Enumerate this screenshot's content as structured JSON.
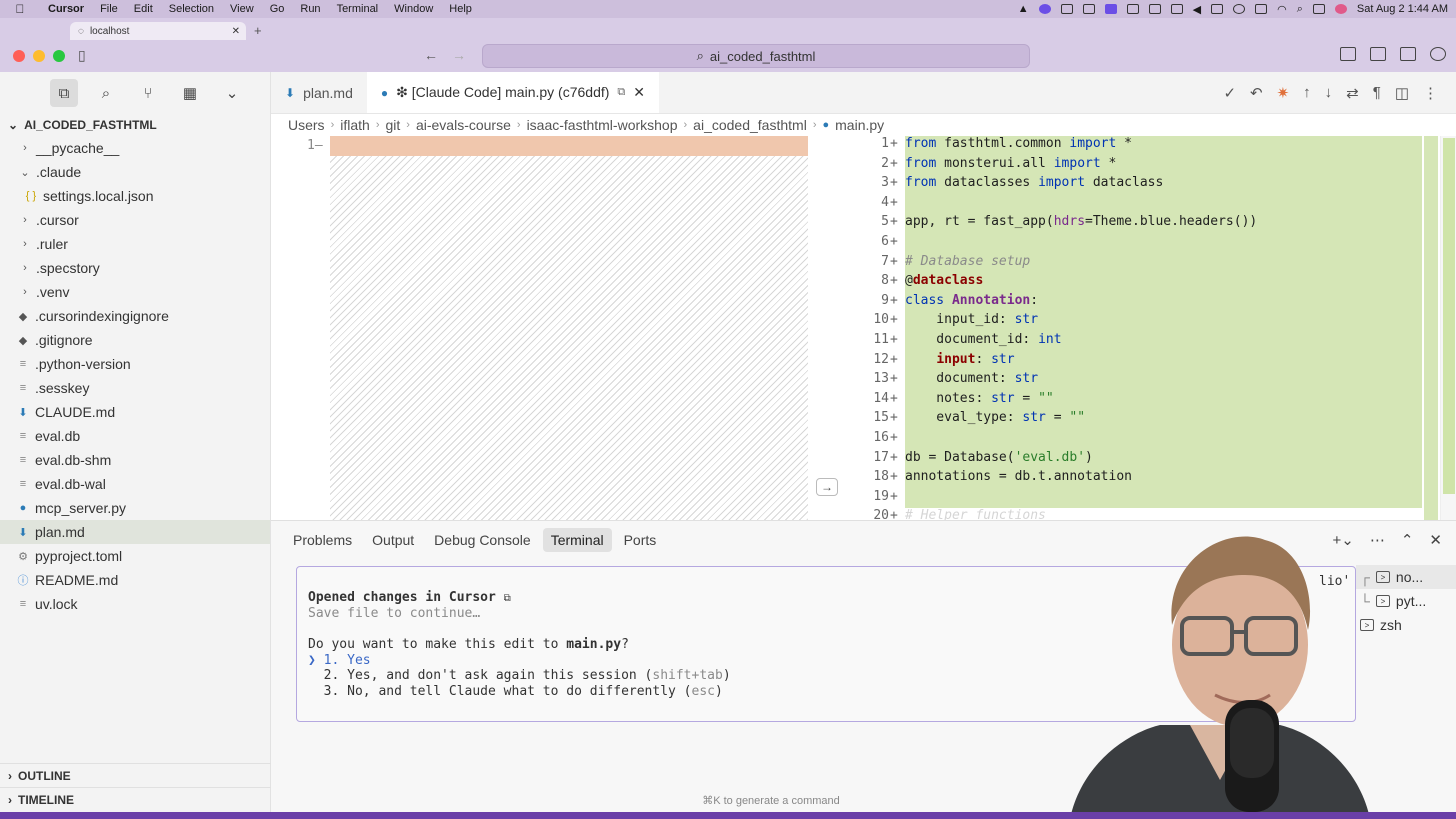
{
  "menubar": {
    "apple": "",
    "items": [
      "Cursor",
      "File",
      "Edit",
      "Selection",
      "View",
      "Go",
      "Run",
      "Terminal",
      "Window",
      "Help"
    ],
    "clock": "Sat Aug 2  1:44 AM",
    "zoom_label": "zm"
  },
  "browser_tab": {
    "title": "localhost"
  },
  "titlebar": {
    "search": "ai_coded_fasthtml"
  },
  "sidebar": {
    "root": "AI_CODED_FASTHTML",
    "items": [
      {
        "label": "__pycache__",
        "kind": "folder",
        "depth": 1,
        "open": false
      },
      {
        "label": ".claude",
        "kind": "folder",
        "depth": 1,
        "open": true
      },
      {
        "label": "settings.local.json",
        "kind": "json",
        "depth": 2
      },
      {
        "label": ".cursor",
        "kind": "folder",
        "depth": 1,
        "open": false
      },
      {
        "label": ".ruler",
        "kind": "folder",
        "depth": 1,
        "open": false
      },
      {
        "label": ".specstory",
        "kind": "folder",
        "depth": 1,
        "open": false
      },
      {
        "label": ".venv",
        "kind": "folder",
        "depth": 1,
        "open": false
      },
      {
        "label": ".cursorindexingignore",
        "kind": "git",
        "depth": 1
      },
      {
        "label": ".gitignore",
        "kind": "git",
        "depth": 1
      },
      {
        "label": ".python-version",
        "kind": "plain",
        "depth": 1
      },
      {
        "label": ".sesskey",
        "kind": "plain",
        "depth": 1
      },
      {
        "label": "CLAUDE.md",
        "kind": "md",
        "depth": 1
      },
      {
        "label": "eval.db",
        "kind": "plain",
        "depth": 1
      },
      {
        "label": "eval.db-shm",
        "kind": "plain",
        "depth": 1
      },
      {
        "label": "eval.db-wal",
        "kind": "plain",
        "depth": 1
      },
      {
        "label": "mcp_server.py",
        "kind": "py",
        "depth": 1
      },
      {
        "label": "plan.md",
        "kind": "md",
        "depth": 1,
        "selected": true
      },
      {
        "label": "pyproject.toml",
        "kind": "gear",
        "depth": 1
      },
      {
        "label": "README.md",
        "kind": "info",
        "depth": 1
      },
      {
        "label": "uv.lock",
        "kind": "plain",
        "depth": 1
      }
    ],
    "outline": "OUTLINE",
    "timeline": "TIMELINE"
  },
  "editor": {
    "tabs": [
      {
        "label": "plan.md",
        "active": false
      },
      {
        "label": "❇ [Claude Code] main.py (c76ddf)",
        "active": true
      }
    ],
    "breadcrumb": [
      "Users",
      "iflath",
      "git",
      "ai-evals-course",
      "isaac-fasthtml-workshop",
      "ai_coded_fasthtml",
      "main.py"
    ],
    "left_line_number": "1",
    "lines": [
      {
        "n": "1",
        "code": "from fasthtml.common import *"
      },
      {
        "n": "2",
        "code": "from monsterui.all import *"
      },
      {
        "n": "3",
        "code": "from dataclasses import dataclass"
      },
      {
        "n": "4",
        "code": ""
      },
      {
        "n": "5",
        "code": "app, rt = fast_app(hdrs=Theme.blue.headers())"
      },
      {
        "n": "6",
        "code": ""
      },
      {
        "n": "7",
        "code": "# Database setup"
      },
      {
        "n": "8",
        "code": "@dataclass"
      },
      {
        "n": "9",
        "code": "class Annotation:"
      },
      {
        "n": "10",
        "code": "    input_id: str"
      },
      {
        "n": "11",
        "code": "    document_id: int"
      },
      {
        "n": "12",
        "code": "    input: str"
      },
      {
        "n": "13",
        "code": "    document: str"
      },
      {
        "n": "14",
        "code": "    notes: str = \"\""
      },
      {
        "n": "15",
        "code": "    eval_type: str = \"\""
      },
      {
        "n": "16",
        "code": ""
      },
      {
        "n": "17",
        "code": "db = Database('eval.db')"
      },
      {
        "n": "18",
        "code": "annotations = db.t.annotation"
      },
      {
        "n": "19",
        "code": ""
      },
      {
        "n": "20",
        "code": "# Helper functions"
      }
    ]
  },
  "panel": {
    "tabs": [
      "Problems",
      "Output",
      "Debug Console",
      "Terminal",
      "Ports"
    ],
    "active_tab": "Terminal",
    "terminal": {
      "opened": "Opened changes in Cursor",
      "save": "Save file to continue…",
      "question_prefix": "Do you want to make this edit to ",
      "question_file": "main.py",
      "question_suffix": "?",
      "opt1": "❯ 1. Yes",
      "opt2_main": "  2. Yes, and don't ask again this session (",
      "opt2_hint": "shift+tab",
      "opt2_end": ")",
      "opt3_main": "  3. No, and tell Claude what to do differently (",
      "opt3_hint": "esc",
      "opt3_end": ")",
      "hint": "⌘K to generate a command",
      "overflow_right": "lio'"
    },
    "terminal_list": [
      "no...",
      "pyt...",
      "zsh"
    ]
  }
}
